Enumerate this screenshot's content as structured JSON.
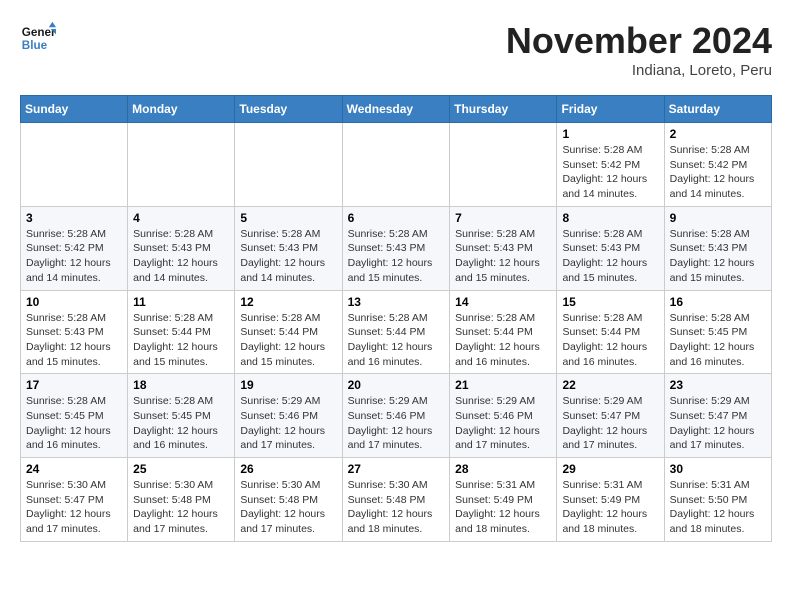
{
  "logo": {
    "line1": "General",
    "line2": "Blue"
  },
  "title": "November 2024",
  "location": "Indiana, Loreto, Peru",
  "days_of_week": [
    "Sunday",
    "Monday",
    "Tuesday",
    "Wednesday",
    "Thursday",
    "Friday",
    "Saturday"
  ],
  "weeks": [
    [
      {
        "day": "",
        "info": ""
      },
      {
        "day": "",
        "info": ""
      },
      {
        "day": "",
        "info": ""
      },
      {
        "day": "",
        "info": ""
      },
      {
        "day": "",
        "info": ""
      },
      {
        "day": "1",
        "info": "Sunrise: 5:28 AM\nSunset: 5:42 PM\nDaylight: 12 hours and 14 minutes."
      },
      {
        "day": "2",
        "info": "Sunrise: 5:28 AM\nSunset: 5:42 PM\nDaylight: 12 hours and 14 minutes."
      }
    ],
    [
      {
        "day": "3",
        "info": "Sunrise: 5:28 AM\nSunset: 5:42 PM\nDaylight: 12 hours and 14 minutes."
      },
      {
        "day": "4",
        "info": "Sunrise: 5:28 AM\nSunset: 5:43 PM\nDaylight: 12 hours and 14 minutes."
      },
      {
        "day": "5",
        "info": "Sunrise: 5:28 AM\nSunset: 5:43 PM\nDaylight: 12 hours and 14 minutes."
      },
      {
        "day": "6",
        "info": "Sunrise: 5:28 AM\nSunset: 5:43 PM\nDaylight: 12 hours and 15 minutes."
      },
      {
        "day": "7",
        "info": "Sunrise: 5:28 AM\nSunset: 5:43 PM\nDaylight: 12 hours and 15 minutes."
      },
      {
        "day": "8",
        "info": "Sunrise: 5:28 AM\nSunset: 5:43 PM\nDaylight: 12 hours and 15 minutes."
      },
      {
        "day": "9",
        "info": "Sunrise: 5:28 AM\nSunset: 5:43 PM\nDaylight: 12 hours and 15 minutes."
      }
    ],
    [
      {
        "day": "10",
        "info": "Sunrise: 5:28 AM\nSunset: 5:43 PM\nDaylight: 12 hours and 15 minutes."
      },
      {
        "day": "11",
        "info": "Sunrise: 5:28 AM\nSunset: 5:44 PM\nDaylight: 12 hours and 15 minutes."
      },
      {
        "day": "12",
        "info": "Sunrise: 5:28 AM\nSunset: 5:44 PM\nDaylight: 12 hours and 15 minutes."
      },
      {
        "day": "13",
        "info": "Sunrise: 5:28 AM\nSunset: 5:44 PM\nDaylight: 12 hours and 16 minutes."
      },
      {
        "day": "14",
        "info": "Sunrise: 5:28 AM\nSunset: 5:44 PM\nDaylight: 12 hours and 16 minutes."
      },
      {
        "day": "15",
        "info": "Sunrise: 5:28 AM\nSunset: 5:44 PM\nDaylight: 12 hours and 16 minutes."
      },
      {
        "day": "16",
        "info": "Sunrise: 5:28 AM\nSunset: 5:45 PM\nDaylight: 12 hours and 16 minutes."
      }
    ],
    [
      {
        "day": "17",
        "info": "Sunrise: 5:28 AM\nSunset: 5:45 PM\nDaylight: 12 hours and 16 minutes."
      },
      {
        "day": "18",
        "info": "Sunrise: 5:28 AM\nSunset: 5:45 PM\nDaylight: 12 hours and 16 minutes."
      },
      {
        "day": "19",
        "info": "Sunrise: 5:29 AM\nSunset: 5:46 PM\nDaylight: 12 hours and 17 minutes."
      },
      {
        "day": "20",
        "info": "Sunrise: 5:29 AM\nSunset: 5:46 PM\nDaylight: 12 hours and 17 minutes."
      },
      {
        "day": "21",
        "info": "Sunrise: 5:29 AM\nSunset: 5:46 PM\nDaylight: 12 hours and 17 minutes."
      },
      {
        "day": "22",
        "info": "Sunrise: 5:29 AM\nSunset: 5:47 PM\nDaylight: 12 hours and 17 minutes."
      },
      {
        "day": "23",
        "info": "Sunrise: 5:29 AM\nSunset: 5:47 PM\nDaylight: 12 hours and 17 minutes."
      }
    ],
    [
      {
        "day": "24",
        "info": "Sunrise: 5:30 AM\nSunset: 5:47 PM\nDaylight: 12 hours and 17 minutes."
      },
      {
        "day": "25",
        "info": "Sunrise: 5:30 AM\nSunset: 5:48 PM\nDaylight: 12 hours and 17 minutes."
      },
      {
        "day": "26",
        "info": "Sunrise: 5:30 AM\nSunset: 5:48 PM\nDaylight: 12 hours and 17 minutes."
      },
      {
        "day": "27",
        "info": "Sunrise: 5:30 AM\nSunset: 5:48 PM\nDaylight: 12 hours and 18 minutes."
      },
      {
        "day": "28",
        "info": "Sunrise: 5:31 AM\nSunset: 5:49 PM\nDaylight: 12 hours and 18 minutes."
      },
      {
        "day": "29",
        "info": "Sunrise: 5:31 AM\nSunset: 5:49 PM\nDaylight: 12 hours and 18 minutes."
      },
      {
        "day": "30",
        "info": "Sunrise: 5:31 AM\nSunset: 5:50 PM\nDaylight: 12 hours and 18 minutes."
      }
    ]
  ]
}
